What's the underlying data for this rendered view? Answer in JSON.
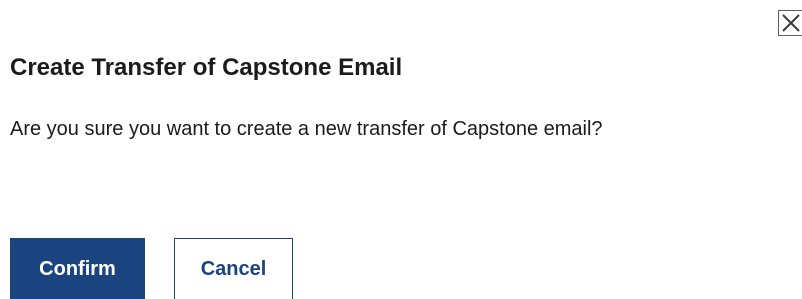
{
  "dialog": {
    "title": "Create Transfer of Capstone Email",
    "message": "Are you sure you want to create a new transfer of Capstone email?",
    "close_icon": "close-icon"
  },
  "actions": {
    "confirm_label": "Confirm",
    "cancel_label": "Cancel"
  },
  "colors": {
    "primary": "#1a4480",
    "text": "#1b1b1b",
    "background": "#ffffff"
  }
}
